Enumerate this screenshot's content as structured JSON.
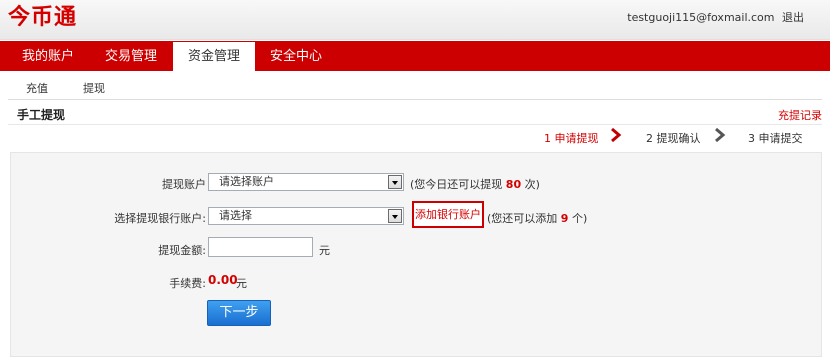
{
  "header": {
    "logo_text": "今币通",
    "user_email": "testguoji115@foxmail.com",
    "logout_label": "退出"
  },
  "nav": {
    "tabs": [
      {
        "label": "我的账户",
        "active": false
      },
      {
        "label": "交易管理",
        "active": false
      },
      {
        "label": "资金管理",
        "active": true
      },
      {
        "label": "安全中心",
        "active": false
      }
    ]
  },
  "subnav": {
    "items": [
      {
        "label": "充值"
      },
      {
        "label": "提现"
      }
    ]
  },
  "page": {
    "title": "手工提现",
    "record_link": "充提记录"
  },
  "steps": [
    {
      "label": "1 申请提现",
      "active": true
    },
    {
      "label": "2 提现确认",
      "active": false
    },
    {
      "label": "3 申请提交",
      "active": false
    }
  ],
  "form": {
    "account_label": "提现账户",
    "account_value": "请选择账户",
    "account_note_prefix": "(您今日还可以提现",
    "account_note_count": "80",
    "account_note_suffix": "次)",
    "bank_label": "选择提现银行账户:",
    "bank_value": "请选择",
    "add_bank_label": "添加银行账户",
    "bank_note_prefix": "(您还可以添加",
    "bank_note_count": "9",
    "bank_note_suffix": "个)",
    "amount_label": "提现金额:",
    "amount_value": "",
    "amount_unit": "元",
    "fee_label": "手续费:",
    "fee_value": "0.00",
    "fee_unit": "元",
    "next_label": "下一步"
  },
  "colors": {
    "brand_red": "#cc0000",
    "accent_red": "#d40000",
    "button_blue": "#1a6fd0"
  }
}
